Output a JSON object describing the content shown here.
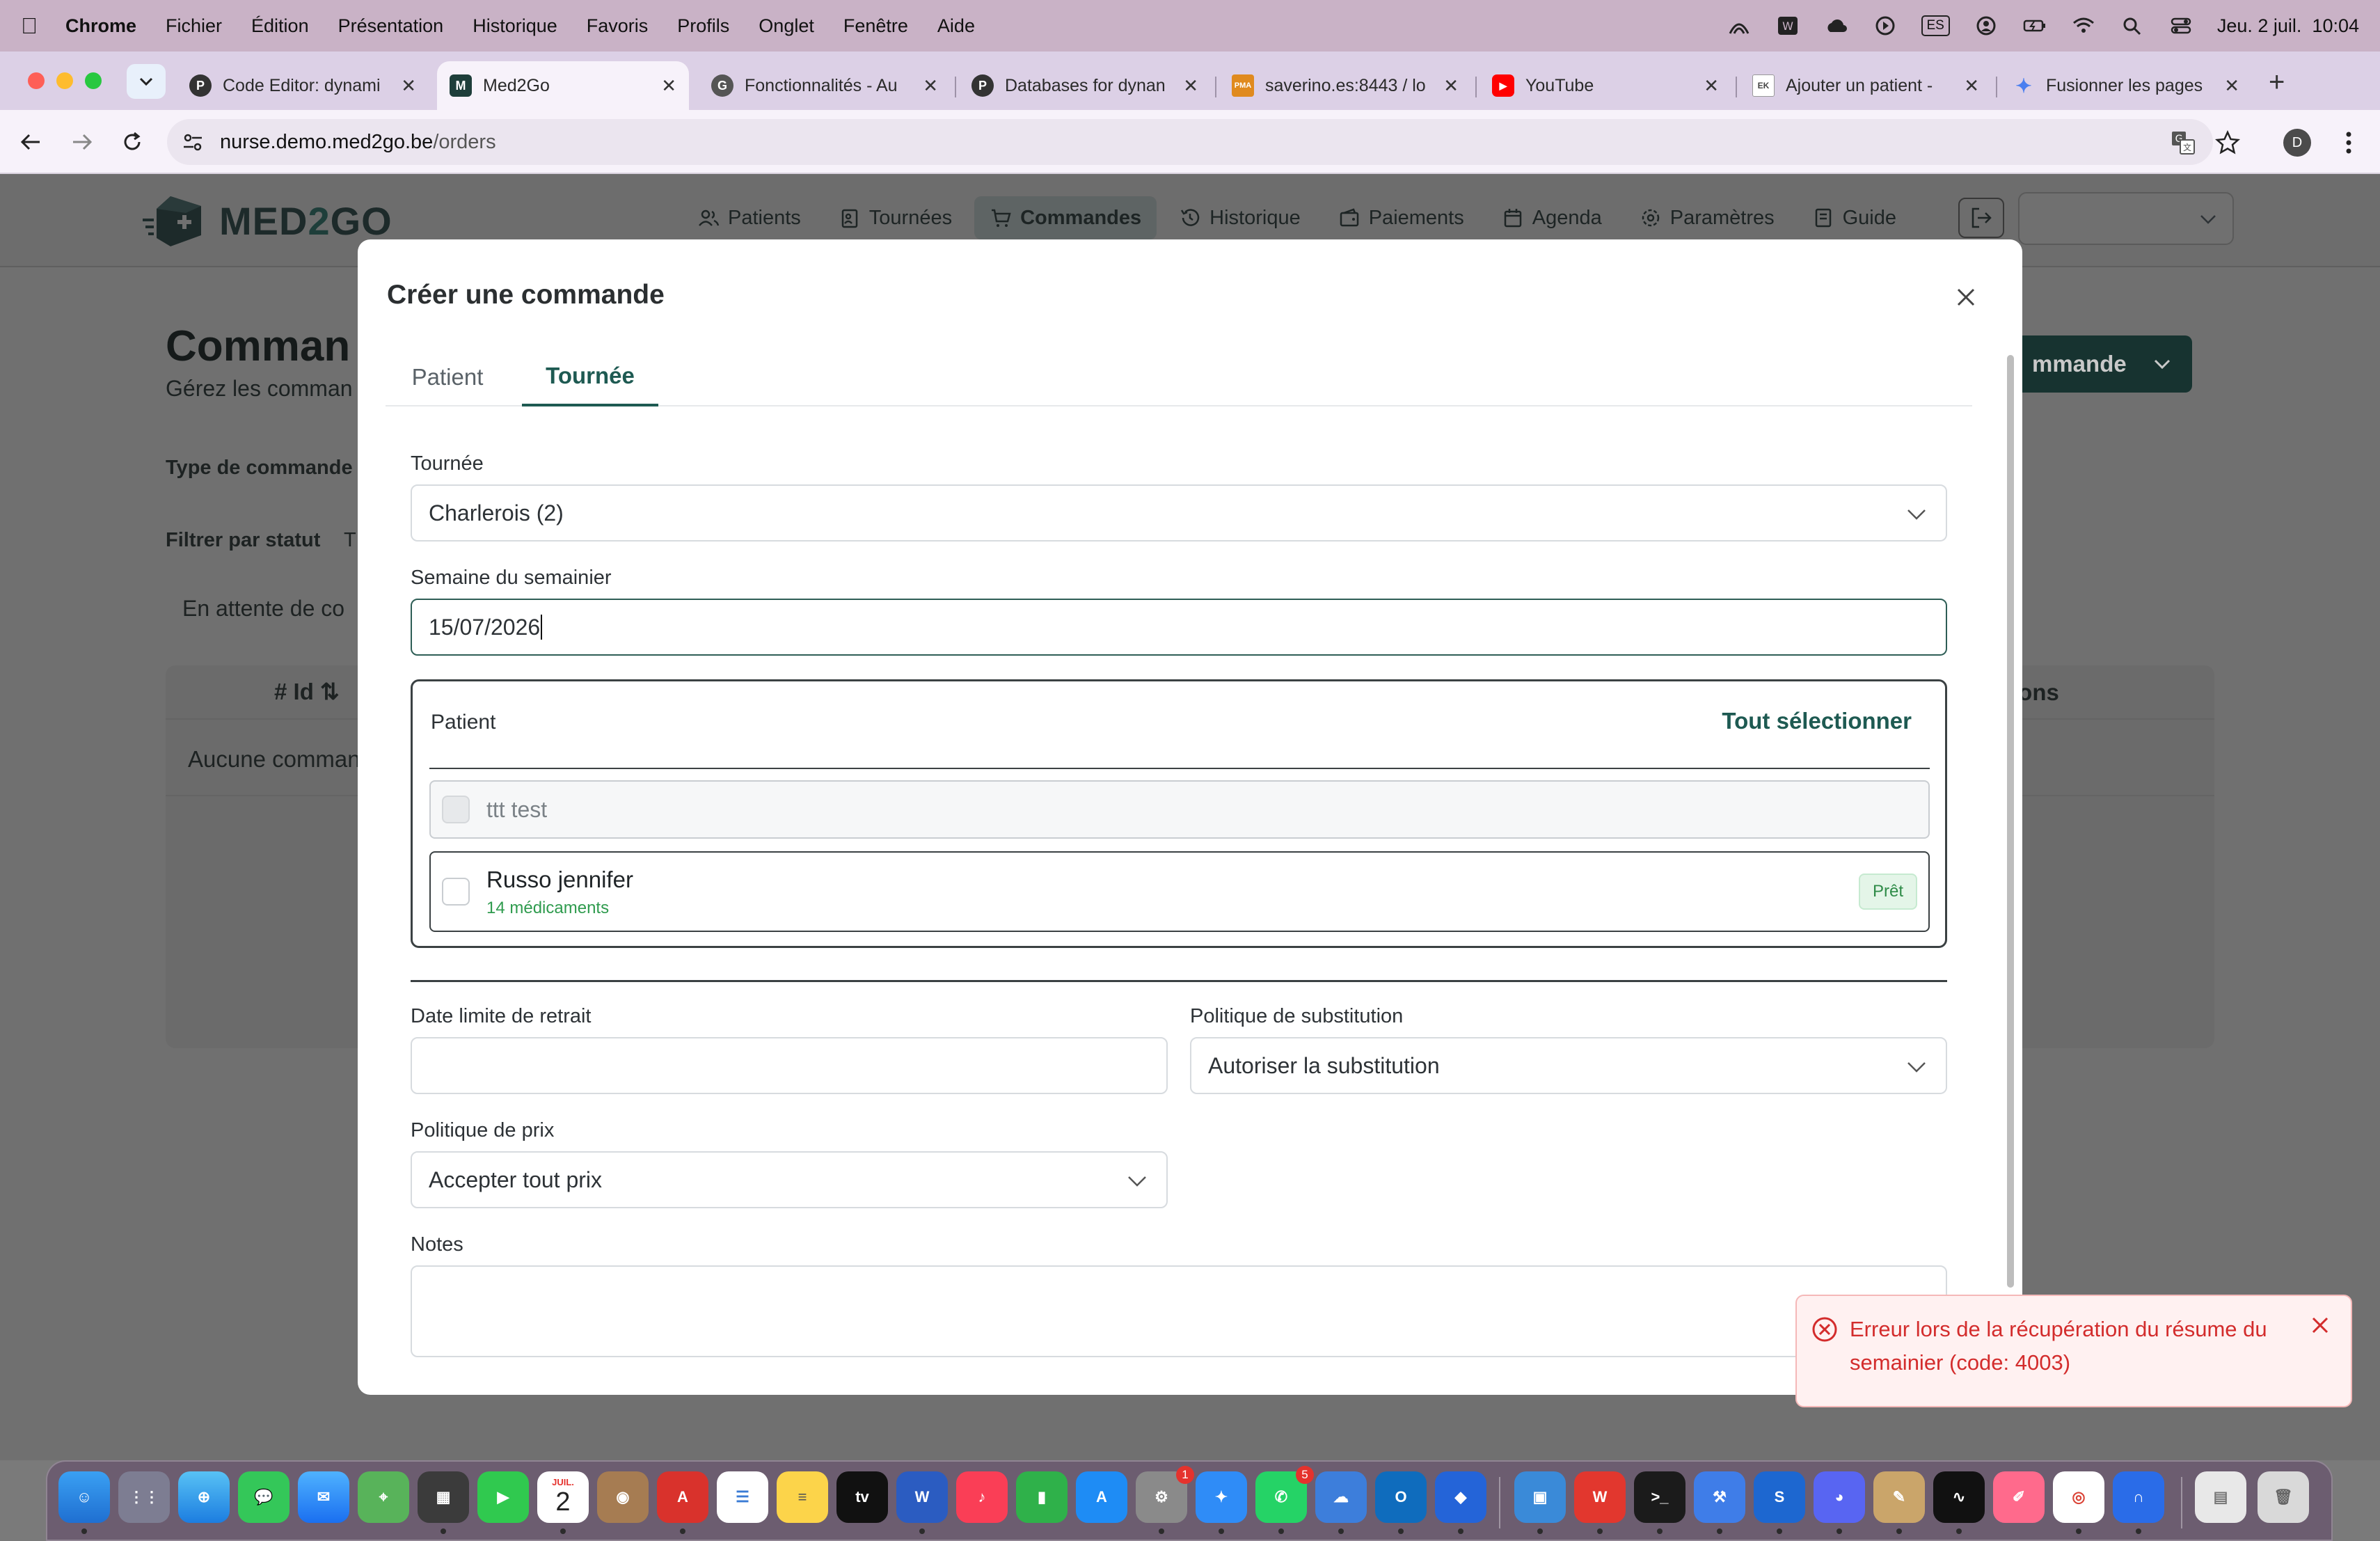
{
  "menubar": {
    "app": "Chrome",
    "items": [
      "Fichier",
      "Édition",
      "Présentation",
      "Historique",
      "Favoris",
      "Profils",
      "Onglet",
      "Fenêtre",
      "Aide"
    ],
    "input_source": "ES",
    "clock": "Jeu. 2 juil.  10:04"
  },
  "tabs": [
    {
      "title": "Code Editor: dynami",
      "favicon": "P",
      "color": "#333333"
    },
    {
      "title": "Med2Go",
      "favicon": "M",
      "color": "#1e3e3a",
      "active": true
    },
    {
      "title": "Fonctionnalités - Au",
      "favicon": "G",
      "color": "#555555"
    },
    {
      "title": "Databases for dynan",
      "favicon": "P",
      "color": "#333333"
    },
    {
      "title": "saverino.es:8443 / lo",
      "favicon": "PMA",
      "color": "#e08a1e"
    },
    {
      "title": "YouTube",
      "favicon": "▶",
      "color": "#ff0000"
    },
    {
      "title": "Ajouter un patient -",
      "favicon": "EK",
      "color": "#666666"
    },
    {
      "title": "Fusionner les pages",
      "favicon": "✦",
      "color": "#4a7ff0"
    }
  ],
  "address": {
    "host": "nurse.demo.med2go.be",
    "path": "/orders",
    "profile_initial": "D"
  },
  "site": {
    "logo_a": "MED",
    "logo_b": "2",
    "logo_c": "GO",
    "nav": [
      {
        "label": "Patients",
        "icon": "users-icon"
      },
      {
        "label": "Tournées",
        "icon": "clipboard-icon"
      },
      {
        "label": "Commandes",
        "icon": "cart-icon",
        "active": true
      },
      {
        "label": "Historique",
        "icon": "history-icon"
      },
      {
        "label": "Paiements",
        "icon": "wallet-icon"
      },
      {
        "label": "Agenda",
        "icon": "calendar-icon"
      },
      {
        "label": "Paramètres",
        "icon": "gear-icon"
      },
      {
        "label": "Guide",
        "icon": "book-icon"
      }
    ]
  },
  "background": {
    "title": "Comman",
    "subtitle": "Gérez les comman",
    "new_button": "mmande",
    "type_label": "Type de commande",
    "status_label": "Filtrer par statut",
    "status_first": "T",
    "filter_text": "En attente de co",
    "col_id": "# Id",
    "col_actions": "tions",
    "empty": "Aucune comman"
  },
  "modal": {
    "title": "Créer une commande",
    "tabs": [
      "Patient",
      "Tournée"
    ],
    "active_tab": "Tournée",
    "tournee_label": "Tournée",
    "tournee_value": "Charlerois (2)",
    "week_label": "Semaine du semainier",
    "week_value": "15/07/2026",
    "patients": {
      "header": "Patient",
      "select_all": "Tout sélectionner",
      "rows": [
        {
          "name": "ttt test",
          "disabled": true
        },
        {
          "name": "Russo jennifer",
          "meds": "14 médicaments",
          "status": "Prêt"
        }
      ]
    },
    "deadline_label": "Date limite de retrait",
    "deadline_value": "",
    "substitution_label": "Politique de substitution",
    "substitution_value": "Autoriser la substitution",
    "price_label": "Politique de prix",
    "price_value": "Accepter tout prix",
    "notes_label": "Notes",
    "notes_value": ""
  },
  "toast": {
    "message": "Erreur lors de la récupération du résume du semainier (code: 4003)",
    "color": "#d32c2c"
  },
  "dock": {
    "calendar_month": "JUIL.",
    "calendar_day": "2",
    "badges": {
      "settings": "1",
      "whatsapp": "5"
    }
  },
  "colors": {
    "brand": "#1e5a52",
    "ready_green": "#2e8b47",
    "error_red": "#d32c2c"
  }
}
